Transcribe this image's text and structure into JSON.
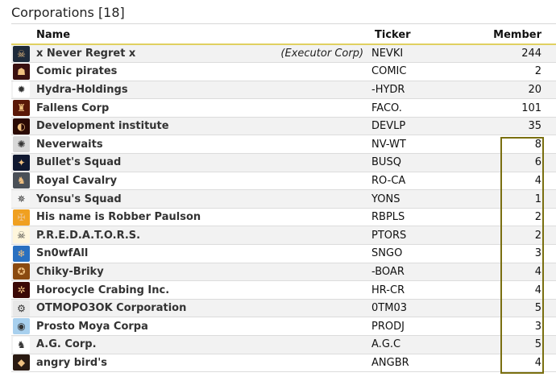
{
  "heading": "Corporations [18]",
  "columns": {
    "name": "Name",
    "ticker": "Ticker",
    "member": "Member"
  },
  "rows": [
    {
      "name": "x Never Regret x",
      "note": "(Executor Corp)",
      "ticker": "NEVKI",
      "member": "244",
      "icon": "skull-logo-icon",
      "logo_bg": "#1e2a3a",
      "logo_glyph": "☠"
    },
    {
      "name": "Comic pirates",
      "note": "",
      "ticker": "COMIC",
      "member": "2",
      "icon": "pirate-logo-icon",
      "logo_bg": "#3a1010",
      "logo_glyph": "☗"
    },
    {
      "name": "Hydra-Holdings",
      "note": "",
      "ticker": "-HYDR",
      "member": "20",
      "icon": "star-burst-logo-icon",
      "logo_bg": "#ffffff",
      "logo_glyph": "✹"
    },
    {
      "name": "Fallens Corp",
      "note": "",
      "ticker": "FACO.",
      "member": "101",
      "icon": "flame-logo-icon",
      "logo_bg": "#5a1808",
      "logo_glyph": "♜"
    },
    {
      "name": "Development institute",
      "note": "",
      "ticker": "DEVLP",
      "member": "35",
      "icon": "orange-emblem-logo-icon",
      "logo_bg": "#2a0a04",
      "logo_glyph": "◐"
    },
    {
      "name": "Neverwaits",
      "note": "",
      "ticker": "NV-WT",
      "member": "8",
      "icon": "grey-emblem-logo-icon",
      "logo_bg": "#d8d8d8",
      "logo_glyph": "✺"
    },
    {
      "name": "Bullet's Squad",
      "note": "",
      "ticker": "BUSQ",
      "member": "6",
      "icon": "blue-blade-logo-icon",
      "logo_bg": "#101830",
      "logo_glyph": "✦"
    },
    {
      "name": "Royal Cavalry",
      "note": "",
      "ticker": "RO-CA",
      "member": "4",
      "icon": "shield-crest-logo-icon",
      "logo_bg": "#4a5058",
      "logo_glyph": "♞"
    },
    {
      "name": "Yonsu's Squad",
      "note": "",
      "ticker": "YONS",
      "member": "1",
      "icon": "white-star-logo-icon",
      "logo_bg": "#f4f4f4",
      "logo_glyph": "✵"
    },
    {
      "name": "His name is Robber Paulson",
      "note": "",
      "ticker": "RBPLS",
      "member": "2",
      "icon": "orange-cross-logo-icon",
      "logo_bg": "#f0a020",
      "logo_glyph": "✠"
    },
    {
      "name": "P.R.E.D.A.T.O.R.S.",
      "note": "",
      "ticker": "PTORS",
      "member": "2",
      "icon": "crossbones-logo-icon",
      "logo_bg": "#fff6dc",
      "logo_glyph": "☠"
    },
    {
      "name": "Sn0wfAll",
      "note": "",
      "ticker": "SNGO",
      "member": "3",
      "icon": "snowflake-logo-icon",
      "logo_bg": "#2a70c0",
      "logo_glyph": "❄"
    },
    {
      "name": "Chiky-Briky",
      "note": "",
      "ticker": "-BOAR",
      "member": "4",
      "icon": "boar-logo-icon",
      "logo_bg": "#8a4a10",
      "logo_glyph": "✪"
    },
    {
      "name": "Horocycle Crabing Inc.",
      "note": "",
      "ticker": "HR-CR",
      "member": "4",
      "icon": "red-wheel-logo-icon",
      "logo_bg": "#3a0806",
      "logo_glyph": "✲"
    },
    {
      "name": "OTMOPO3OK Corporation",
      "note": "",
      "ticker": "0TM03",
      "member": "5",
      "icon": "ring-emblem-logo-icon",
      "logo_bg": "#e8e8e8",
      "logo_glyph": "⚙"
    },
    {
      "name": "Prosto Moya Corpa",
      "note": "",
      "ticker": "PRODJ",
      "member": "3",
      "icon": "blue-orb-logo-icon",
      "logo_bg": "#a8d0ee",
      "logo_glyph": "◉"
    },
    {
      "name": "A.G. Corp.",
      "note": "",
      "ticker": "A.G.C",
      "member": "5",
      "icon": "wolf-logo-icon",
      "logo_bg": "#ffffff",
      "logo_glyph": "♞"
    },
    {
      "name": "angry bird's",
      "note": "",
      "ticker": "ANGBR",
      "member": "4",
      "icon": "bird-logo-icon",
      "logo_bg": "#2a1a12",
      "logo_glyph": "◆"
    }
  ],
  "colors": {
    "header_rule": "#e0d060",
    "highlight_box": "#7a6f10",
    "row_alt": "#f2f2f2"
  }
}
